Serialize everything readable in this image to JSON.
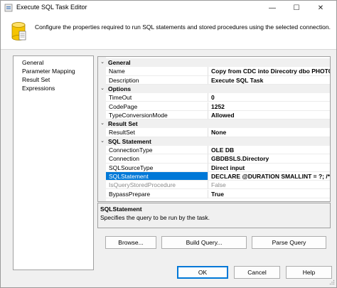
{
  "window": {
    "title": "Execute SQL Task Editor"
  },
  "titlebar": {
    "minimize": "—",
    "maximize": "☐",
    "close": "✕"
  },
  "header": {
    "text": "Configure the properties required to run SQL statements and stored procedures using the selected connection."
  },
  "nav": {
    "items": [
      "General",
      "Parameter Mapping",
      "Result Set",
      "Expressions"
    ]
  },
  "grid": {
    "categories": {
      "general": "General",
      "options": "Options",
      "result_set": "Result Set",
      "sql_statement": "SQL Statement"
    },
    "toggle_glyph": "⌄",
    "props": {
      "name": {
        "label": "Name",
        "value": "Copy from CDC into Direcotry dbo PHOTOCOPY"
      },
      "description": {
        "label": "Description",
        "value": "Execute SQL Task"
      },
      "timeout": {
        "label": "TimeOut",
        "value": "0"
      },
      "codepage": {
        "label": "CodePage",
        "value": "1252"
      },
      "typeconv": {
        "label": "TypeConversionMode",
        "value": "Allowed"
      },
      "resultset": {
        "label": "ResultSet",
        "value": "None"
      },
      "conntype": {
        "label": "ConnectionType",
        "value": "OLE DB"
      },
      "connection": {
        "label": "Connection",
        "value": "GBDBSLS.Directory"
      },
      "sqlsourcetype": {
        "label": "SQLSourceType",
        "value": "Direct input"
      },
      "sqlstatement": {
        "label": "SQLStatement",
        "value": "DECLARE @DURATION SMALLINT = ?; /* Ne..."
      },
      "isquery": {
        "label": "IsQueryStoredProcedure",
        "value": "False"
      },
      "bypass": {
        "label": "BypassPrepare",
        "value": "True"
      }
    }
  },
  "description": {
    "title": "SQLStatement",
    "text": "Specifies the query to be run by the task."
  },
  "buttons": {
    "browse": "Browse...",
    "build_query": "Build Query...",
    "parse_query": "Parse Query",
    "ok": "OK",
    "cancel": "Cancel",
    "help": "Help"
  }
}
